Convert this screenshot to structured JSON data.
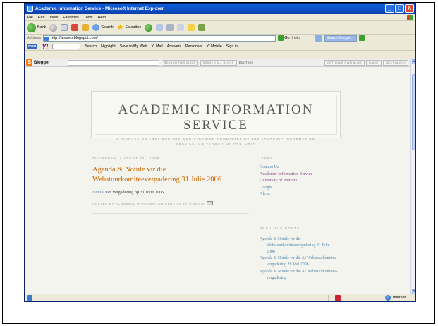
{
  "window": {
    "title": "Academic Information Service - Microsoft Internet Explorer",
    "controls": [
      "_",
      "□",
      "X"
    ]
  },
  "menubar": {
    "items": [
      "File",
      "Edit",
      "View",
      "Favorites",
      "Tools",
      "Help"
    ]
  },
  "toolbar": {
    "back_label": "Back",
    "search_label": "Search",
    "favorites_label": "Favorites"
  },
  "addressbar": {
    "label": "Address",
    "url": "http://aisweb.blogspot.com/",
    "go_label": "Go",
    "links_label": "Links",
    "live_search_placeholder": "Search Google"
  },
  "yahoo_toolbar": {
    "items": [
      "Search",
      "Highlight",
      "Save to My Web",
      "Y! Mail",
      "Answers",
      "Personals",
      "Y! Mobile",
      "Sign in"
    ]
  },
  "blogger_bar": {
    "logo": "Blogger",
    "search_this_blog": "Search This Blog",
    "search_all_blogs": "Search All Blogs",
    "blog_this": "BlogThis!",
    "get_your_own": "Get Your Own Blog",
    "flag": "Flag?",
    "next_blog": "Next Blog»"
  },
  "blog": {
    "title": "ACADEMIC INFORMATION SERVICE",
    "description": "A DISCUSSION AREA FOR THE WEB STEERING COMMITTEE OF THE ACADEMIC INFORMATION SERVICE, UNIVERSITY OF PRETORIA"
  },
  "post": {
    "date": "THURSDAY, AUGUST 31, 2006",
    "title": "Agenda & Notule vir die Webstuurkomiteevergadering 31 Julie 2006",
    "body_link": "Notule",
    "body_text": " van vergadering op 31 Julie 2006.",
    "footer": "POSTED BY ACADEMIC INFORMATION SERVICE AT 9:48 PM"
  },
  "sidebar": {
    "links_heading": "LINKS",
    "links": [
      "Contact Us",
      "Academic Information Service",
      "University of Pretoria",
      "Google",
      "Alexa"
    ],
    "previous_heading": "PREVIOUS POSTS",
    "previous_posts": [
      "Agenda & Notule vir die Webstuurkomiteevergadering 31 Julie 2006",
      "Agenda & Notule vir die AI Webstuurkomitee-vergadering 29 Mei 2006",
      "Agenda & Notule vir die AI Webstuurkomitee-vergadering"
    ]
  },
  "statusbar": {
    "zone": "Internet"
  }
}
